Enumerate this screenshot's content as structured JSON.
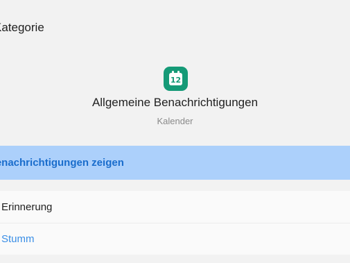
{
  "header": {
    "title": "Kategorie"
  },
  "app": {
    "icon": "calendar-icon",
    "icon_color": "#159a77",
    "icon_day": "12",
    "channel_name": "Allgemeine Benachrichtigungen",
    "app_name": "Kalender"
  },
  "toggle": {
    "label": "Benachrichtigungen zeigen",
    "highlight_color": "#acd0fb",
    "label_color": "#1a6dcc"
  },
  "options": [
    {
      "label": "Erinnerung"
    },
    {
      "label": "Stumm"
    }
  ]
}
